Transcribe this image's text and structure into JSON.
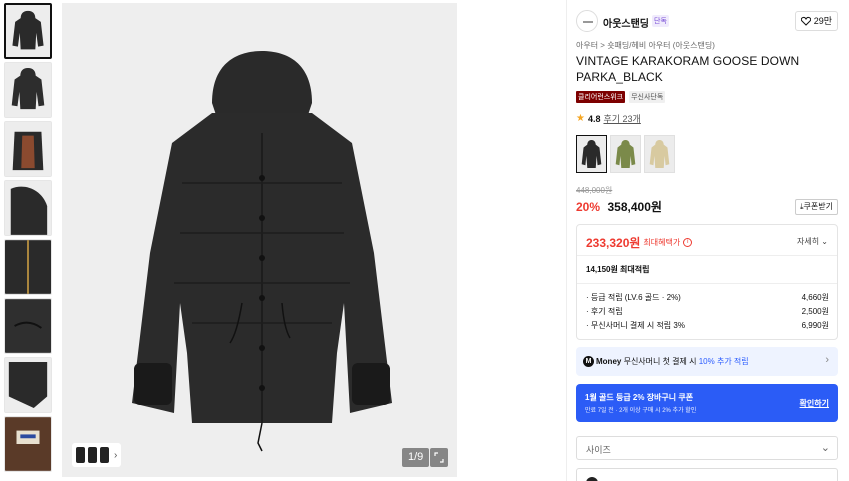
{
  "gallery": {
    "thumbnails": [
      "thumb-front",
      "thumb-back",
      "thumb-open-lining",
      "thumb-detail-hood",
      "thumb-detail-zipper",
      "thumb-detail-drawstring",
      "thumb-detail-cuff",
      "thumb-label"
    ],
    "counter": "1/9",
    "colors": {
      "jacket": "#2a2a2a",
      "bg": "#eeeeee"
    }
  },
  "brand": {
    "name": "아웃스탠딩",
    "badge": "단독",
    "likes": "29만"
  },
  "breadcrumb": "아우터 > 숏패딩/헤비 아우터 (아웃스탠딩)",
  "product": {
    "title": "VINTAGE KARAKORAM GOOSE DOWN PARKA_BLACK",
    "tags": [
      "클리어런스위크",
      "무신사단독"
    ],
    "rating": "4.8",
    "reviews": "후기 23개",
    "swatch_colors": [
      "#2a2a2a",
      "#7b8a4a",
      "#d8caa0"
    ]
  },
  "pricing": {
    "original": "448,000원",
    "discount": "20%",
    "price": "358,400원",
    "coupon_label": "쿠폰받기"
  },
  "benefit": {
    "amount": "233,320원",
    "label": "최대혜택가",
    "detail": "자세히",
    "max_earn": "14,150원 최대적립",
    "rows": [
      {
        "label": "· 등급 적립 (LV.6 골드 · 2%)",
        "amount": "4,660원"
      },
      {
        "label": "· 후기 적립",
        "amount": "2,500원"
      },
      {
        "label": "· 무신사머니 결제 시 적립 3%",
        "amount": "6,990원"
      }
    ]
  },
  "money": {
    "brand": "Money",
    "text": "무신사머니 첫 결제 시",
    "highlight": "10% 추가 적립"
  },
  "coupon_banner": {
    "title": "1월 골드 등급 2% 장바구니 쿠폰",
    "subtitle": "만료 7일 전 · 2개 이상 구매 시 2% 추가 할인",
    "action": "확인하기",
    "color": "#2b5cf6"
  },
  "size": {
    "placeholder": "사이즈"
  }
}
